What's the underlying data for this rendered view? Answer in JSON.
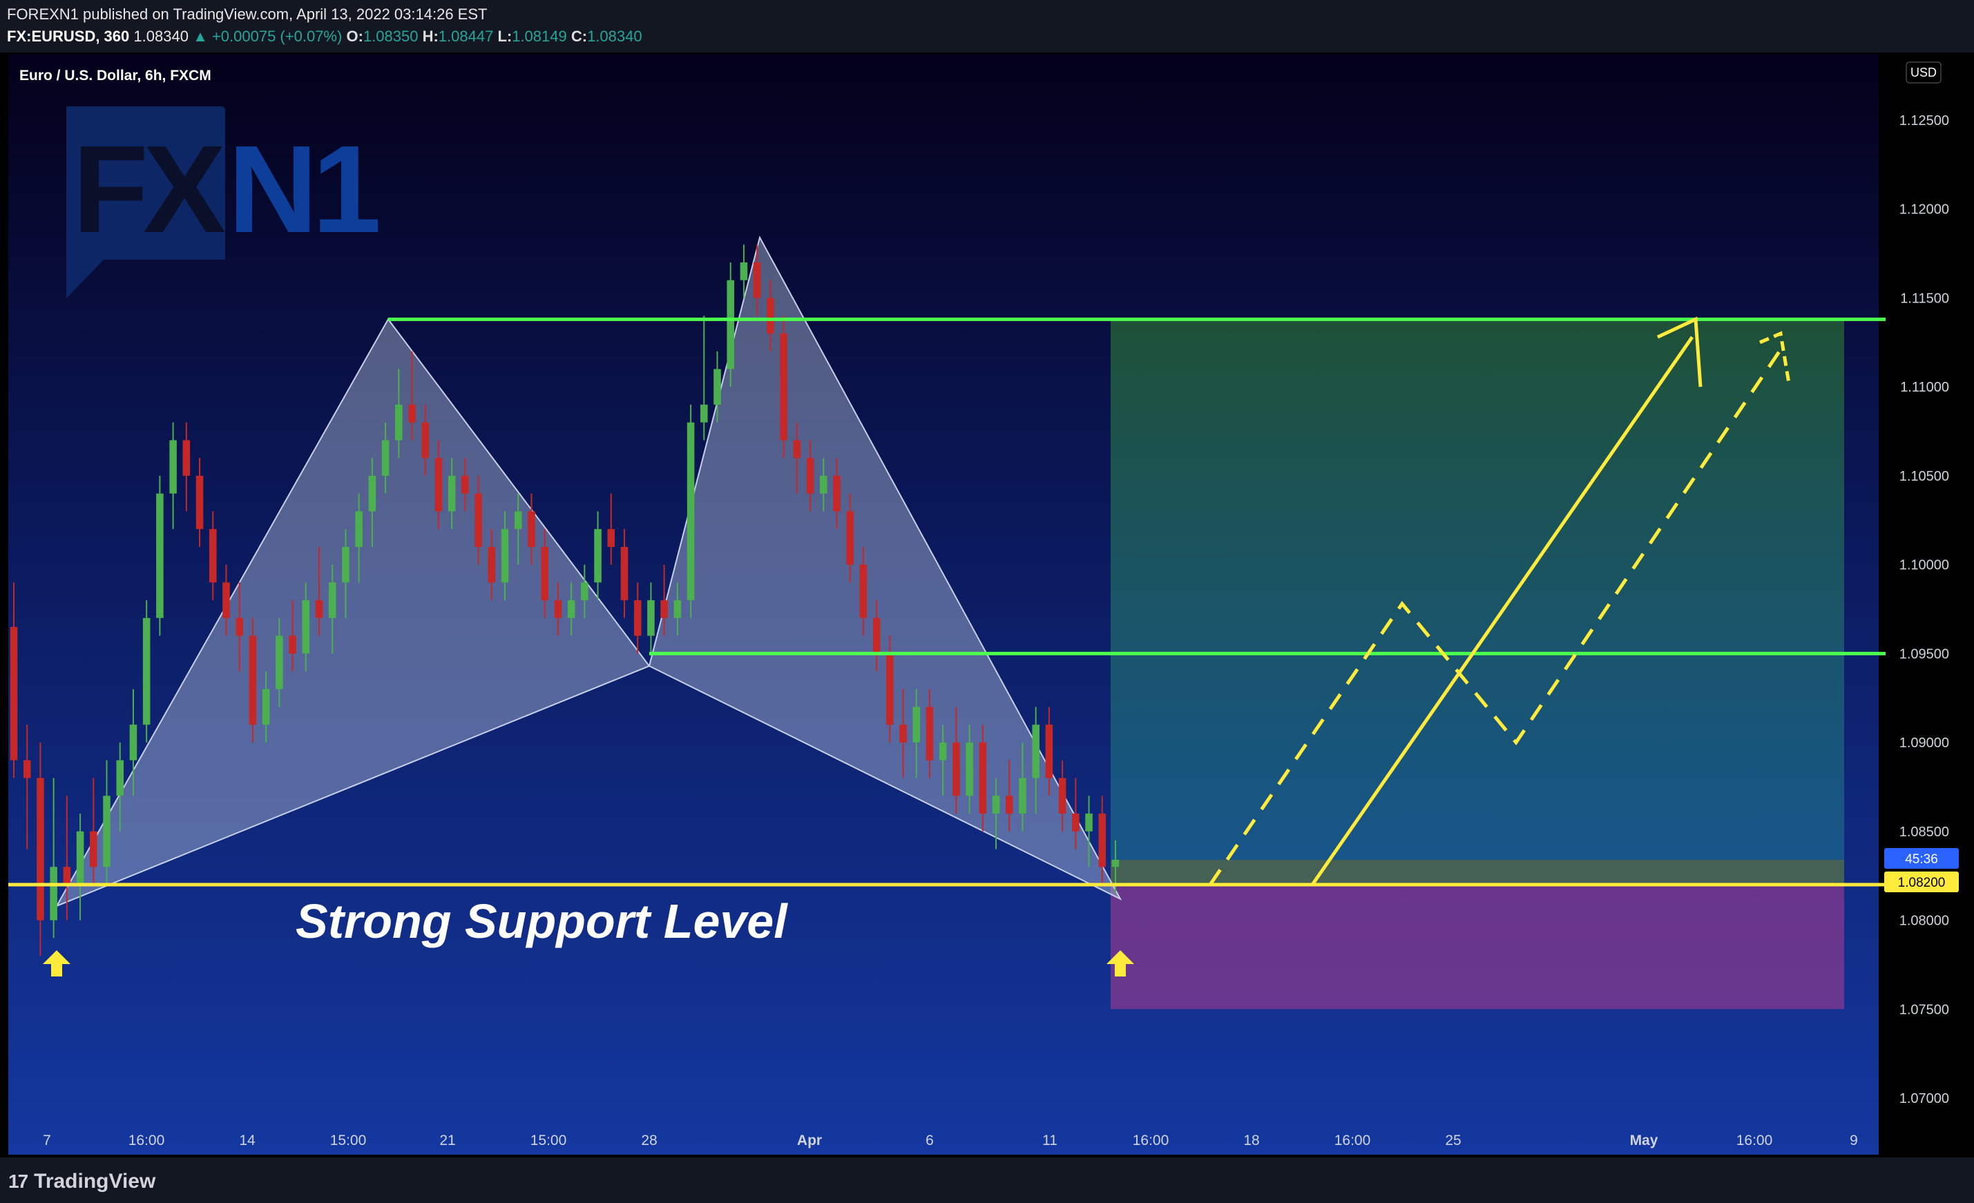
{
  "header": {
    "publisher_line": "FOREXN1 published on TradingView.com, April 13, 2022 03:14:26 EST",
    "symbol": "FX:EURUSD, 360",
    "last": "1.08340",
    "change": "▲ +0.00075 (+0.07%)",
    "open_label": "O:",
    "open": "1.08350",
    "high_label": "H:",
    "high": "1.08447",
    "low_label": "L:",
    "low": "1.08149",
    "close_label": "C:",
    "close": "1.08340"
  },
  "chart_title": "Euro / U.S. Dollar, 6h, FXCM",
  "currency_badge": "USD",
  "logo_text": "FXN1",
  "annotation": "Strong Support Level",
  "countdown": "45:36",
  "footer_brand": "TradingView",
  "colors": {
    "bg_top": "#04001a",
    "bg_bottom": "#1438a0",
    "up": "#4caf50",
    "down": "#c62828",
    "level_green": "#4cff4c",
    "support_yellow": "#ffeb3b",
    "profit_zone": "#2e7d32",
    "loss_zone": "#8e3a8e",
    "harmonic_fill": "#b0bcd8"
  },
  "chart_data": {
    "type": "candlestick",
    "title": "Euro / U.S. Dollar, 6h, FXCM",
    "y_ticks": [
      "1.12500",
      "1.12000",
      "1.11500",
      "1.11000",
      "1.10500",
      "1.10000",
      "1.09500",
      "1.09000",
      "1.08500",
      "1.08000",
      "1.07500",
      "1.07000"
    ],
    "x_ticks": [
      "7",
      "16:00",
      "14",
      "15:00",
      "21",
      "15:00",
      "28",
      "Apr",
      "6",
      "11",
      "16:00",
      "18",
      "16:00",
      "25",
      "May",
      "16:00",
      "9"
    ],
    "levels": [
      {
        "name": "resistance",
        "price": 1.1138
      },
      {
        "name": "mid",
        "price": 1.095
      },
      {
        "name": "support",
        "price": 1.082
      }
    ],
    "current_price_label": "1.08200",
    "zones": {
      "profit_top": 1.1138,
      "entry": 1.0834,
      "stop": 1.075
    },
    "candles": [
      [
        1.0965,
        1.099,
        1.088,
        1.089
      ],
      [
        1.089,
        1.091,
        1.084,
        1.088
      ],
      [
        1.088,
        1.09,
        1.078,
        1.08
      ],
      [
        1.08,
        1.088,
        1.079,
        1.083
      ],
      [
        1.083,
        1.087,
        1.08,
        1.082
      ],
      [
        1.082,
        1.086,
        1.08,
        1.085
      ],
      [
        1.085,
        1.088,
        1.082,
        1.083
      ],
      [
        1.083,
        1.089,
        1.082,
        1.087
      ],
      [
        1.087,
        1.09,
        1.085,
        1.089
      ],
      [
        1.089,
        1.093,
        1.087,
        1.091
      ],
      [
        1.091,
        1.098,
        1.09,
        1.097
      ],
      [
        1.097,
        1.105,
        1.096,
        1.104
      ],
      [
        1.104,
        1.108,
        1.102,
        1.107
      ],
      [
        1.107,
        1.108,
        1.103,
        1.105
      ],
      [
        1.105,
        1.106,
        1.101,
        1.102
      ],
      [
        1.102,
        1.103,
        1.098,
        1.099
      ],
      [
        1.099,
        1.1,
        1.096,
        1.097
      ],
      [
        1.097,
        1.099,
        1.094,
        1.096
      ],
      [
        1.096,
        1.097,
        1.09,
        1.091
      ],
      [
        1.091,
        1.094,
        1.09,
        1.093
      ],
      [
        1.093,
        1.097,
        1.092,
        1.096
      ],
      [
        1.096,
        1.098,
        1.094,
        1.095
      ],
      [
        1.095,
        1.099,
        1.094,
        1.098
      ],
      [
        1.098,
        1.101,
        1.096,
        1.097
      ],
      [
        1.097,
        1.1,
        1.095,
        1.099
      ],
      [
        1.099,
        1.102,
        1.097,
        1.101
      ],
      [
        1.101,
        1.104,
        1.099,
        1.103
      ],
      [
        1.103,
        1.106,
        1.101,
        1.105
      ],
      [
        1.105,
        1.108,
        1.104,
        1.107
      ],
      [
        1.107,
        1.111,
        1.106,
        1.109
      ],
      [
        1.109,
        1.112,
        1.107,
        1.108
      ],
      [
        1.108,
        1.109,
        1.105,
        1.106
      ],
      [
        1.106,
        1.107,
        1.102,
        1.103
      ],
      [
        1.103,
        1.106,
        1.102,
        1.105
      ],
      [
        1.105,
        1.106,
        1.103,
        1.104
      ],
      [
        1.104,
        1.105,
        1.1,
        1.101
      ],
      [
        1.101,
        1.102,
        1.098,
        1.099
      ],
      [
        1.099,
        1.103,
        1.098,
        1.102
      ],
      [
        1.102,
        1.104,
        1.1,
        1.103
      ],
      [
        1.103,
        1.104,
        1.1,
        1.101
      ],
      [
        1.101,
        1.102,
        1.097,
        1.098
      ],
      [
        1.098,
        1.099,
        1.096,
        1.097
      ],
      [
        1.097,
        1.099,
        1.096,
        1.098
      ],
      [
        1.098,
        1.1,
        1.097,
        1.099
      ],
      [
        1.099,
        1.103,
        1.098,
        1.102
      ],
      [
        1.102,
        1.104,
        1.1,
        1.101
      ],
      [
        1.101,
        1.102,
        1.097,
        1.098
      ],
      [
        1.098,
        1.099,
        1.095,
        1.096
      ],
      [
        1.096,
        1.099,
        1.095,
        1.098
      ],
      [
        1.098,
        1.1,
        1.096,
        1.097
      ],
      [
        1.097,
        1.099,
        1.096,
        1.098
      ],
      [
        1.098,
        1.109,
        1.097,
        1.108
      ],
      [
        1.108,
        1.114,
        1.107,
        1.109
      ],
      [
        1.109,
        1.112,
        1.108,
        1.111
      ],
      [
        1.111,
        1.117,
        1.11,
        1.116
      ],
      [
        1.116,
        1.118,
        1.115,
        1.117
      ],
      [
        1.117,
        1.118,
        1.114,
        1.115
      ],
      [
        1.115,
        1.116,
        1.112,
        1.113
      ],
      [
        1.113,
        1.114,
        1.106,
        1.107
      ],
      [
        1.107,
        1.108,
        1.104,
        1.106
      ],
      [
        1.106,
        1.107,
        1.103,
        1.104
      ],
      [
        1.104,
        1.106,
        1.103,
        1.105
      ],
      [
        1.105,
        1.106,
        1.102,
        1.103
      ],
      [
        1.103,
        1.104,
        1.099,
        1.1
      ],
      [
        1.1,
        1.101,
        1.096,
        1.097
      ],
      [
        1.097,
        1.098,
        1.094,
        1.095
      ],
      [
        1.095,
        1.096,
        1.09,
        1.091
      ],
      [
        1.091,
        1.093,
        1.088,
        1.09
      ],
      [
        1.09,
        1.093,
        1.088,
        1.092
      ],
      [
        1.092,
        1.093,
        1.088,
        1.089
      ],
      [
        1.089,
        1.091,
        1.087,
        1.09
      ],
      [
        1.09,
        1.092,
        1.086,
        1.087
      ],
      [
        1.087,
        1.091,
        1.086,
        1.09
      ],
      [
        1.09,
        1.091,
        1.085,
        1.086
      ],
      [
        1.086,
        1.088,
        1.084,
        1.087
      ],
      [
        1.087,
        1.089,
        1.085,
        1.086
      ],
      [
        1.086,
        1.09,
        1.085,
        1.088
      ],
      [
        1.088,
        1.092,
        1.086,
        1.091
      ],
      [
        1.091,
        1.092,
        1.087,
        1.088
      ],
      [
        1.088,
        1.089,
        1.085,
        1.086
      ],
      [
        1.086,
        1.088,
        1.084,
        1.085
      ],
      [
        1.085,
        1.087,
        1.083,
        1.086
      ],
      [
        1.086,
        1.087,
        1.082,
        1.083
      ],
      [
        1.083,
        1.0845,
        1.0815,
        1.0834
      ]
    ]
  }
}
